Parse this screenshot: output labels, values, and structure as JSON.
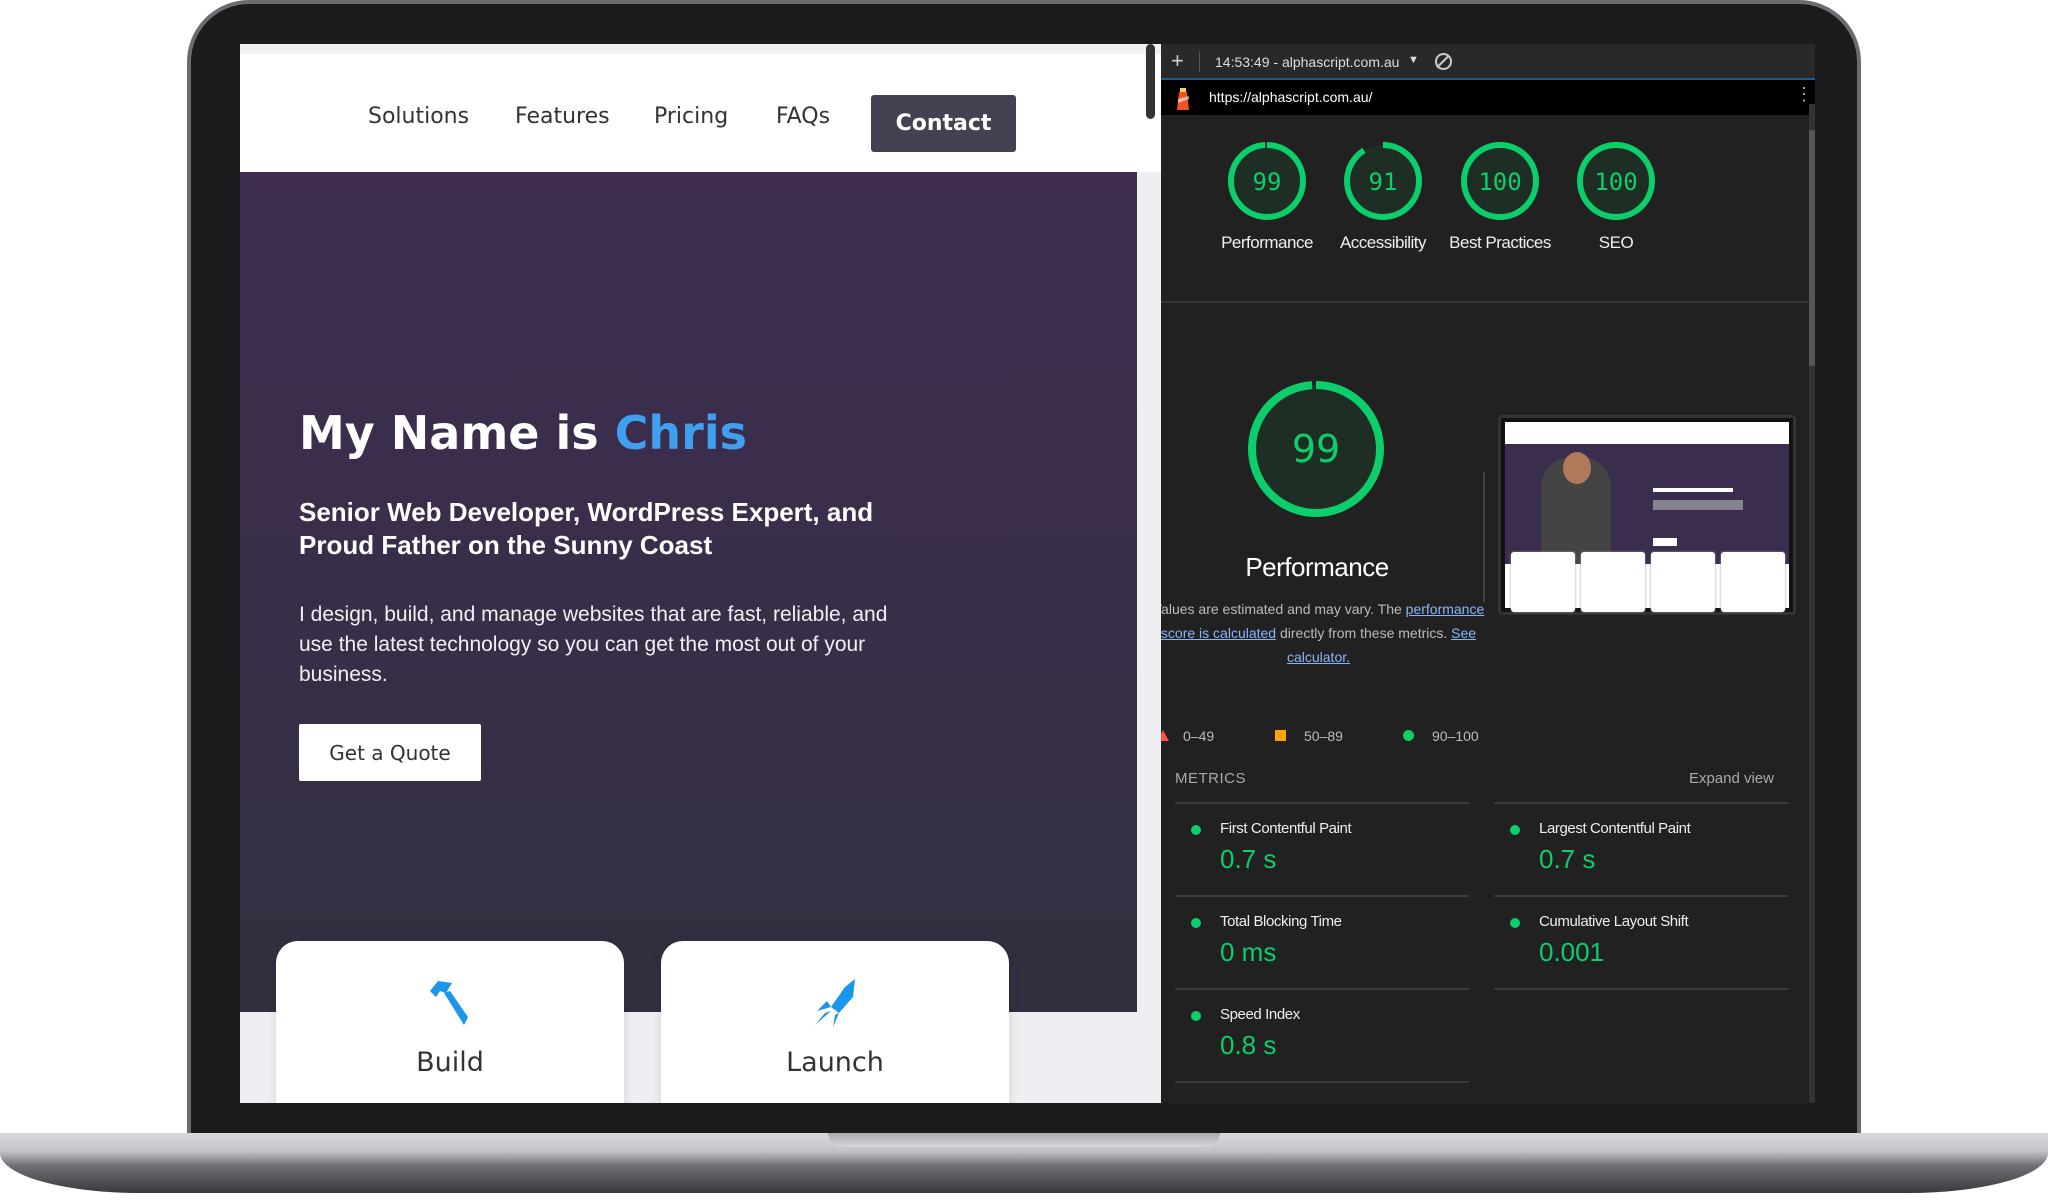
{
  "site": {
    "nav": [
      {
        "label": "Solutions"
      },
      {
        "label": "Features"
      },
      {
        "label": "Pricing"
      },
      {
        "label": "FAQs"
      }
    ],
    "contact_label": "Contact",
    "hero": {
      "title_prefix": "My Name is ",
      "title_name": "Chris",
      "subtitle": "Senior Web Developer, WordPress Expert, and Proud Father on the Sunny Coast",
      "paragraph": "I design, build, and manage websites that are fast, reliable, and use the latest technology so you can get the most out of your business.",
      "cta": "Get a Quote"
    },
    "cards": [
      {
        "label": "Build",
        "icon": "hammer-icon"
      },
      {
        "label": "Launch",
        "icon": "rocket-icon"
      }
    ],
    "accent": "#3fa0f0"
  },
  "lighthouse": {
    "toolbar": {
      "session": "14:53:49 - alphascript.com.au",
      "url": "https://alphascript.com.au/"
    },
    "scores": [
      {
        "label": "Performance",
        "value": 99
      },
      {
        "label": "Accessibility",
        "value": 91
      },
      {
        "label": "Best Practices",
        "value": 100
      },
      {
        "label": "SEO",
        "value": 100
      }
    ],
    "main": {
      "value": 99,
      "label": "Performance",
      "desc_1": "Values are estimated and may vary. The ",
      "desc_link": "performance score is calculated",
      "desc_2": " directly from these metrics. ",
      "desc_link2": "See calculator."
    },
    "legend": [
      {
        "label": "0–49",
        "color": "#ff4e42"
      },
      {
        "label": "50–89",
        "color": "#ffa400"
      },
      {
        "label": "90–100",
        "color": "#0cce6b"
      }
    ],
    "metrics_title": "METRICS",
    "expand_label": "Expand view",
    "metrics": [
      {
        "name": "First Contentful Paint",
        "value": "0.7 s"
      },
      {
        "name": "Largest Contentful Paint",
        "value": "0.7 s"
      },
      {
        "name": "Total Blocking Time",
        "value": "0 ms"
      },
      {
        "name": "Cumulative Layout Shift",
        "value": "0.001"
      },
      {
        "name": "Speed Index",
        "value": "0.8 s"
      }
    ],
    "good_color": "#0cce6b"
  }
}
